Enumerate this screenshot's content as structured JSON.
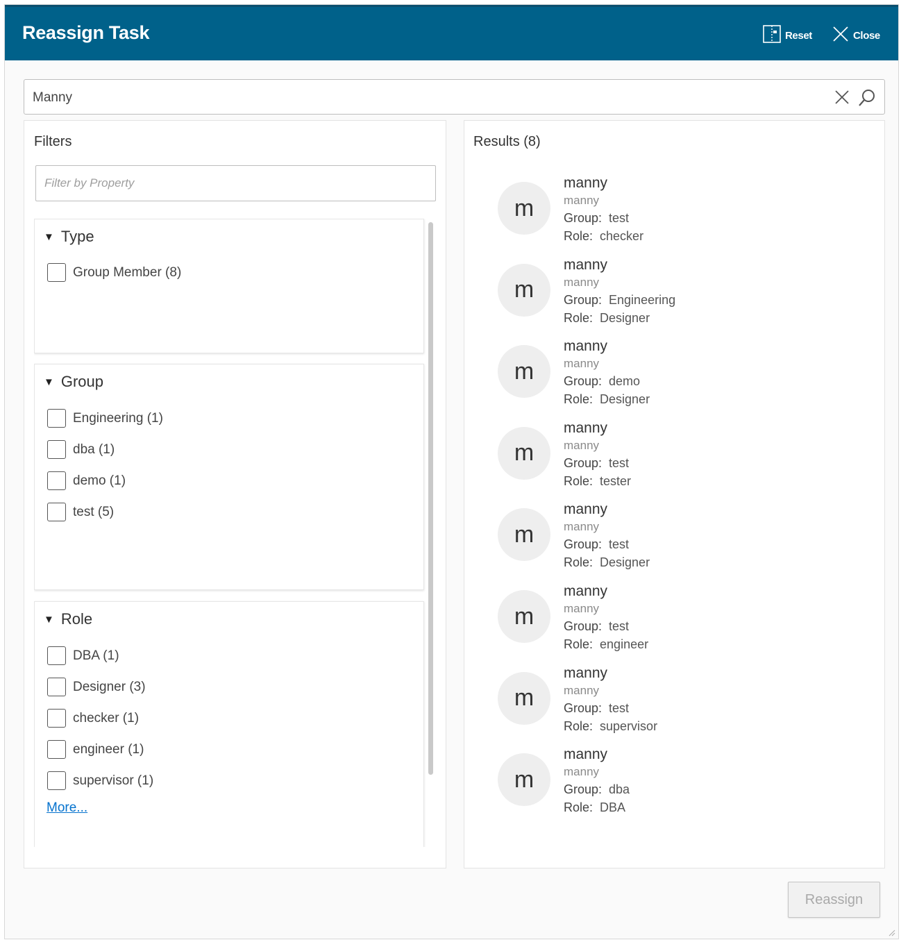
{
  "dialog": {
    "title": "Reassign Task",
    "reset_label": "Reset",
    "close_label": "Close"
  },
  "search": {
    "value": "Manny"
  },
  "filters": {
    "title": "Filters",
    "placeholder": "Filter by Property",
    "type": {
      "title": "Type",
      "options": [
        {
          "label": "Group Member (8)"
        }
      ]
    },
    "group": {
      "title": "Group",
      "options": [
        {
          "label": "Engineering (1)"
        },
        {
          "label": "dba (1)"
        },
        {
          "label": "demo (1)"
        },
        {
          "label": "test (5)"
        }
      ]
    },
    "role": {
      "title": "Role",
      "options": [
        {
          "label": "DBA (1)"
        },
        {
          "label": "Designer (3)"
        },
        {
          "label": "checker (1)"
        },
        {
          "label": "engineer (1)"
        },
        {
          "label": "supervisor (1)"
        }
      ],
      "more_label": "More..."
    }
  },
  "results": {
    "title": "Results (8)",
    "group_key": "Group:",
    "role_key": "Role:",
    "items": [
      {
        "initial": "m",
        "name": "manny",
        "username": "manny",
        "group": "test",
        "role": "checker"
      },
      {
        "initial": "m",
        "name": "manny",
        "username": "manny",
        "group": "Engineering",
        "role": "Designer"
      },
      {
        "initial": "m",
        "name": "manny",
        "username": "manny",
        "group": "demo",
        "role": "Designer"
      },
      {
        "initial": "m",
        "name": "manny",
        "username": "manny",
        "group": "test",
        "role": "tester"
      },
      {
        "initial": "m",
        "name": "manny",
        "username": "manny",
        "group": "test",
        "role": "Designer"
      },
      {
        "initial": "m",
        "name": "manny",
        "username": "manny",
        "group": "test",
        "role": "engineer"
      },
      {
        "initial": "m",
        "name": "manny",
        "username": "manny",
        "group": "test",
        "role": "supervisor"
      },
      {
        "initial": "m",
        "name": "manny",
        "username": "manny",
        "group": "dba",
        "role": "DBA"
      }
    ]
  },
  "footer": {
    "reassign_label": "Reassign"
  },
  "colors": {
    "header_bg": "#00618a",
    "link": "#0572ce"
  }
}
